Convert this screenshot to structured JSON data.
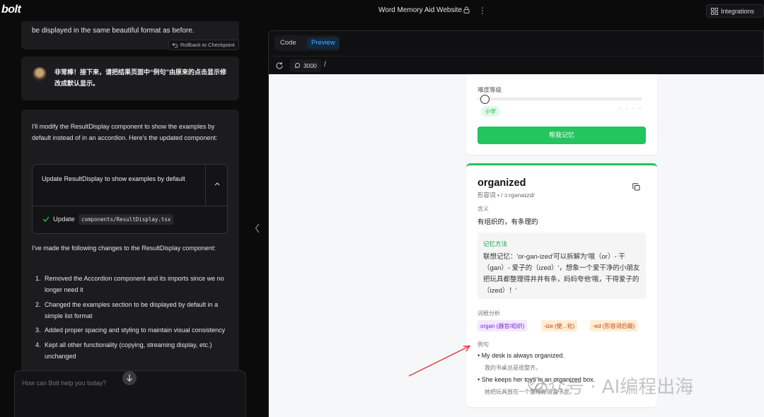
{
  "app": {
    "logo": "bolt",
    "window_title": "Word Memory Aid Website",
    "integrations_label": "Integrations"
  },
  "chat": {
    "prev_message_tail": "be displayed in the same beautiful format as before.",
    "rollback_label": "Rollback to Checkpoint",
    "user_message": "非常棒！接下来，请把结果页面中“例句”由原来的点击显示修改成默认显示。",
    "bot_intro": "I'll modify the ResultDisplay component to show the examples by default instead of in an accordion. Here's the updated component:",
    "action": {
      "title": "Update ResultDisplay to show examples by default",
      "step_label": "Update",
      "step_file": "components/ResultDisplay.tsx"
    },
    "bot_summary": "I've made the following changes to the ResultDisplay component:",
    "changes": [
      {
        "num": "1.",
        "text": "Removed the Accordion component and its imports since we no longer need it"
      },
      {
        "num": "2.",
        "text": "Changed the examples section to be displayed by default in a simple list format"
      },
      {
        "num": "3.",
        "text": "Added proper spacing and styling to maintain visual consistency"
      },
      {
        "num": "4.",
        "text": "Kept all other functionality (copying, streaming display, etc.) unchanged"
      }
    ],
    "prompt_placeholder": "How can Bolt help you today?"
  },
  "preview": {
    "tab_code": "Code",
    "tab_preview": "Preview",
    "port": "3000",
    "path": "/"
  },
  "app_page": {
    "difficulty_label": "难度等级",
    "difficulty_value": 0.03,
    "level_badge": "小学",
    "level_dots": "· · · ·",
    "memorize_button": "帮我记忆",
    "word": "organized",
    "pos_phonetic": "形容词 • / ɔ:rɡənaɪzd/",
    "meaning_label": "含义",
    "meaning": "有组织的，有条理的",
    "memory_title": "记忆方法",
    "memory_text": "联想记忆：'or-gan-ized'可以拆解为'哦（or）- 干（gan）- 爱子的（ized）'，想象一个爱干净的小朋友把玩具都整理得井井有条，妈妈夸他'哦，干得爱子的（ized）！'",
    "etymology_label": "词根分析",
    "etymology_chips": [
      "organ (器官/组织)",
      "-ize (使...化)",
      "-ed (形容词后缀)"
    ],
    "examples_label": "例句",
    "examples": [
      {
        "en": "• My desk is always organized.",
        "zh": "我的书桌总是很整齐。"
      },
      {
        "en": "• She keeps her toys in an organized box.",
        "zh": "她把玩具放在一个整理好的盒子里。"
      }
    ]
  },
  "watermark": "公众号 · AI编程出海",
  "colors": {
    "accent_green": "#22c55e",
    "preview_tab_blue": "#4ea9ff",
    "annotation_red": "#e53935"
  }
}
